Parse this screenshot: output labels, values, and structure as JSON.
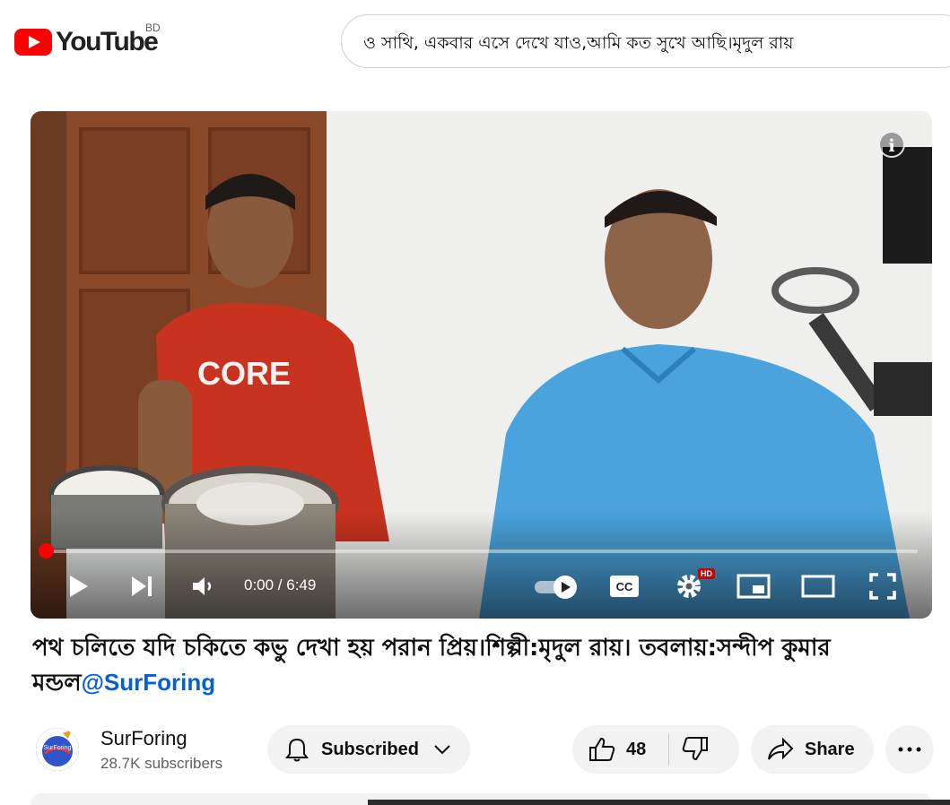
{
  "header": {
    "logo_text": "YouTube",
    "country_code": "BD",
    "search_value": "ও সাথি, একবার এসে দেখে যাও,আমি কত সুখে আছি।মৃদুল রায়"
  },
  "player": {
    "current_time": "0:00",
    "duration": "6:49",
    "time_display": "0:00 / 6:49",
    "progress": 0,
    "hd_badge": "HD",
    "info_icon_label": "i",
    "shirt_text": "CORE"
  },
  "video": {
    "title_text": "পথ চলিতে যদি চকিতে কভু দেখা হয় পরান প্রিয়।শিল্পী:মৃদুল রায়। তবলায়:সন্দীপ কুমার মন্ডল",
    "title_mention": "@SurForing"
  },
  "owner": {
    "channel_name": "SurForing",
    "subscriber_count": "28.7K subscribers",
    "avatar_text": "SurForing"
  },
  "actions": {
    "subscribe_label": "Subscribed",
    "like_count": "48",
    "share_label": "Share"
  },
  "colors": {
    "accent_red": "#ff0000",
    "link_blue": "#065fd4",
    "pill_bg": "#f2f2f2"
  }
}
